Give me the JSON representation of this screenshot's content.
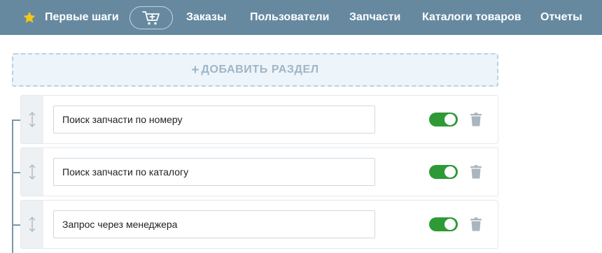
{
  "nav": {
    "first_steps": "Первые шаги",
    "star_icon": "star-icon",
    "cart_icon": "cart-add-icon",
    "links": [
      "Заказы",
      "Пользователи",
      "Запчасти",
      "Каталоги товаров",
      "Отчеты"
    ],
    "background_color": "#6689a0"
  },
  "add_section": {
    "plus": "+",
    "label": "ДОБАВИТЬ РАЗДЕЛ"
  },
  "sections": [
    {
      "name": "Поиск запчасти по номеру",
      "enabled": true
    },
    {
      "name": "Поиск запчасти по каталогу",
      "enabled": true
    },
    {
      "name": "Запрос через менеджера",
      "enabled": true
    }
  ],
  "colors": {
    "toggle_on": "#2e9a36",
    "star": "#f5c518",
    "tree_line": "#7797ab"
  },
  "icons": {
    "drag": "drag-vertical-icon",
    "trash": "trash-icon"
  }
}
